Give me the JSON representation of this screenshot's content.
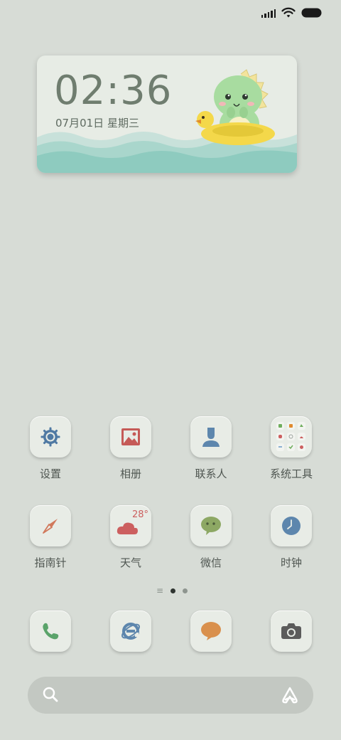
{
  "status_bar": {
    "signal_icon": "signal-icon",
    "wifi_icon": "wifi-icon",
    "battery_icon": "battery-icon"
  },
  "widget": {
    "time": "02:36",
    "date": "07月01日 星期三"
  },
  "apps": [
    {
      "label": "设置",
      "icon": "settings-gear-icon",
      "color": "#4f79a3"
    },
    {
      "label": "相册",
      "icon": "gallery-icon",
      "color": "#c55a57"
    },
    {
      "label": "联系人",
      "icon": "contacts-icon",
      "color": "#5d86ad"
    },
    {
      "label": "系统工具",
      "icon": "system-tools-folder-icon",
      "color": "#e8ece6"
    },
    {
      "label": "指南针",
      "icon": "compass-icon",
      "color": "#d1785b"
    },
    {
      "label": "天气",
      "icon": "weather-icon",
      "temperature": "28°",
      "color": "#cc5f5f"
    },
    {
      "label": "微信",
      "icon": "wechat-icon",
      "color": "#8da864"
    },
    {
      "label": "时钟",
      "icon": "clock-icon",
      "color": "#5d86ad"
    }
  ],
  "page_indicator": {
    "lines": "≡",
    "pages": 2,
    "active_page": 1
  },
  "dock": [
    {
      "label": "电话",
      "icon": "phone-icon",
      "color": "#5aa36a"
    },
    {
      "label": "浏览器",
      "icon": "browser-icon",
      "color": "#5d86ad"
    },
    {
      "label": "短信",
      "icon": "messages-icon",
      "color": "#d9904d"
    },
    {
      "label": "相机",
      "icon": "camera-icon",
      "color": "#5b5b5b"
    }
  ],
  "search_bar": {
    "search_icon": "search-icon",
    "assistant_icon": "assistant-icon"
  }
}
